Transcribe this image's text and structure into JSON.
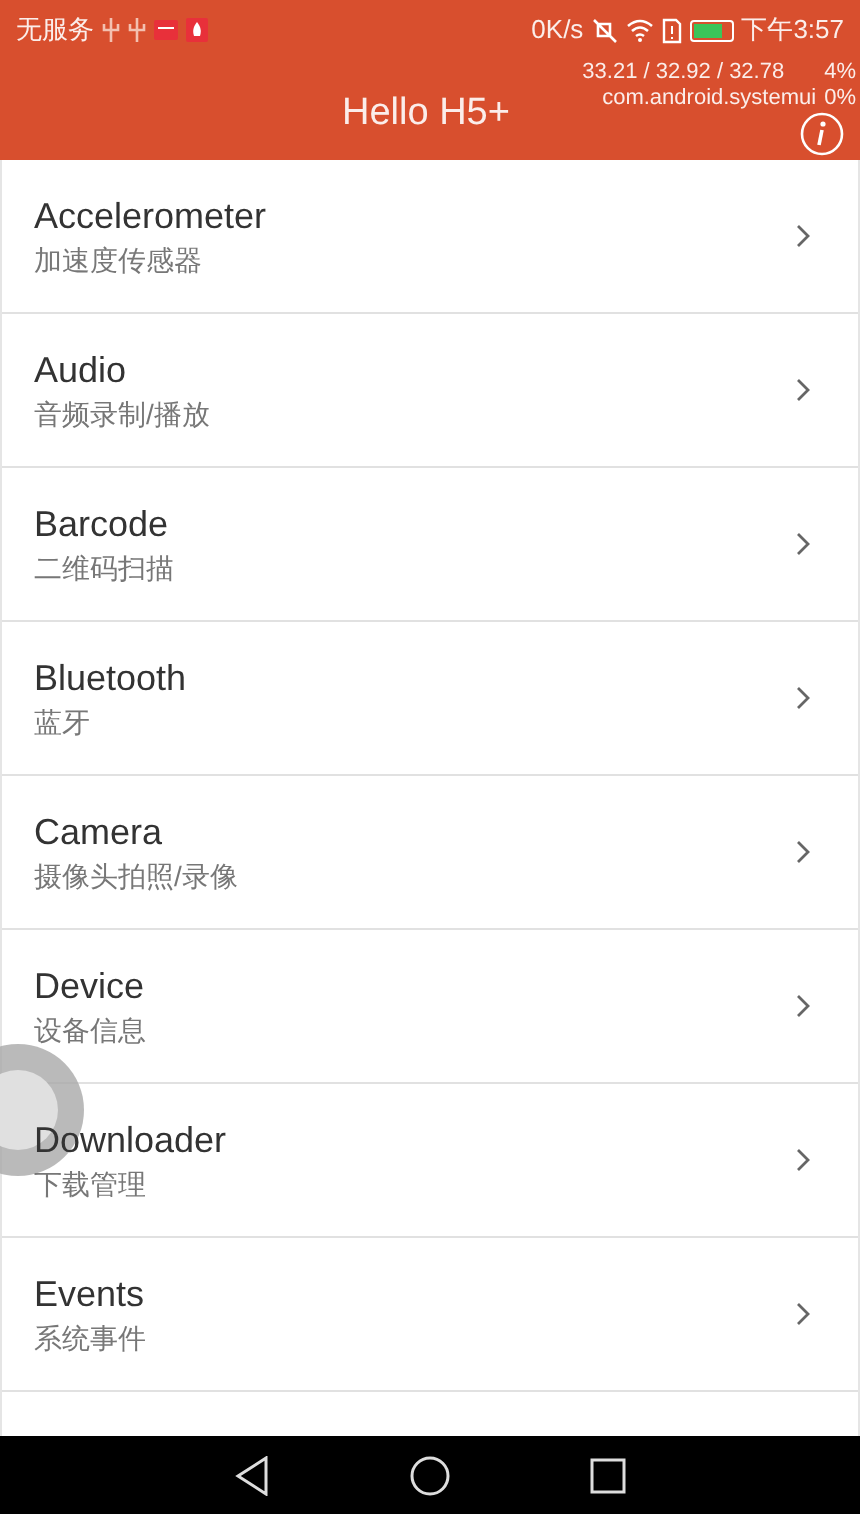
{
  "status_bar": {
    "carrier": "无服务",
    "speed": "0K/s",
    "time": "下午3:57"
  },
  "debug_overlay": {
    "load": "33.21 / 32.92 / 32.78",
    "load_percent": "4%",
    "process": "com.android.systemui",
    "process_percent": "0%"
  },
  "header": {
    "title": "Hello H5+"
  },
  "items": [
    {
      "title": "Accelerometer",
      "subtitle": "加速度传感器"
    },
    {
      "title": "Audio",
      "subtitle": "音频录制/播放"
    },
    {
      "title": "Barcode",
      "subtitle": "二维码扫描"
    },
    {
      "title": "Bluetooth",
      "subtitle": "蓝牙"
    },
    {
      "title": "Camera",
      "subtitle": "摄像头拍照/录像"
    },
    {
      "title": "Device",
      "subtitle": "设备信息"
    },
    {
      "title": "Downloader",
      "subtitle": "下载管理"
    },
    {
      "title": "Events",
      "subtitle": "系统事件"
    }
  ]
}
